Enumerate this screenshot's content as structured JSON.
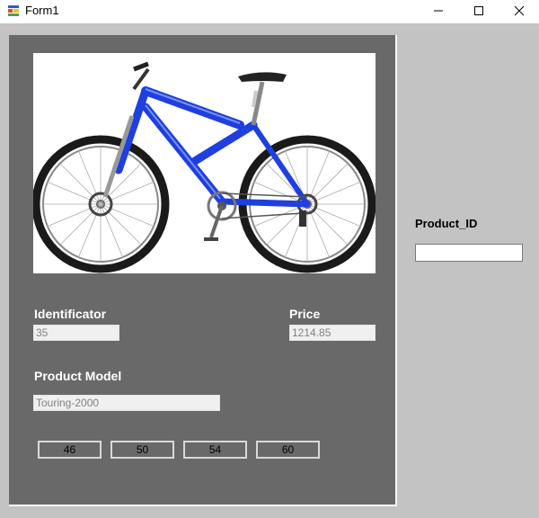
{
  "window": {
    "title": "Form1"
  },
  "form": {
    "identificator_label": "Identificator",
    "identificator_value": "35",
    "price_label": "Price",
    "price_value": "1214.85",
    "model_label": "Product Model",
    "model_value": "Touring-2000",
    "size_buttons": [
      "46",
      "50",
      "54",
      "60"
    ]
  },
  "sidebar": {
    "product_id_label": "Product_ID",
    "product_id_value": ""
  },
  "colors": {
    "panel": "#696969",
    "window_bg": "#c3c3c3",
    "bike_frame": "#1f3fe0"
  },
  "icons": {
    "app": "form-app-icon",
    "minimize": "minimize-icon",
    "maximize": "maximize-icon",
    "close": "close-icon"
  }
}
